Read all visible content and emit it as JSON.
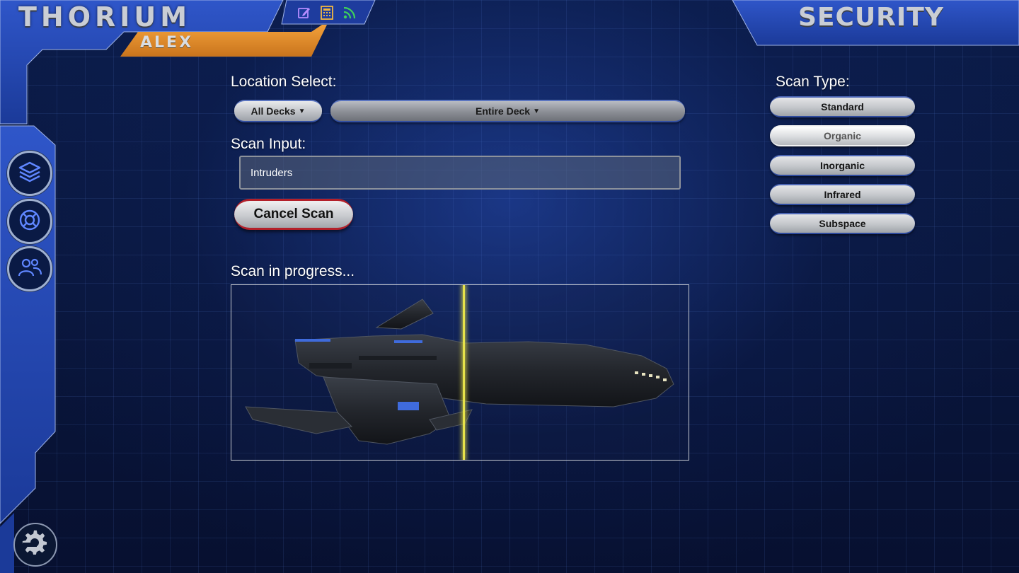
{
  "header": {
    "brand": "THORIUM",
    "user": "ALEX",
    "station": "SECURITY",
    "icons": [
      "edit-icon",
      "calculator-icon",
      "rss-icon"
    ]
  },
  "sidebar": {
    "items": [
      {
        "icon": "layers-icon"
      },
      {
        "icon": "lifebuoy-icon"
      },
      {
        "icon": "users-icon"
      }
    ],
    "settings_icon": "gear-icon"
  },
  "location": {
    "label": "Location Select:",
    "deck": "All Decks",
    "room": "Entire Deck"
  },
  "scan_input": {
    "label": "Scan Input:",
    "value": "Intruders"
  },
  "actions": {
    "cancel_label": "Cancel Scan"
  },
  "status": {
    "text": "Scan in progress..."
  },
  "scan_types": {
    "label": "Scan Type:",
    "items": [
      "Standard",
      "Organic",
      "Inorganic",
      "Infrared",
      "Subspace"
    ],
    "selected": "Organic"
  },
  "colors": {
    "accent_blue": "#2a4fbf",
    "accent_orange": "#e08a2a",
    "danger": "#b3202a",
    "scan_line": "#e6e24a"
  }
}
